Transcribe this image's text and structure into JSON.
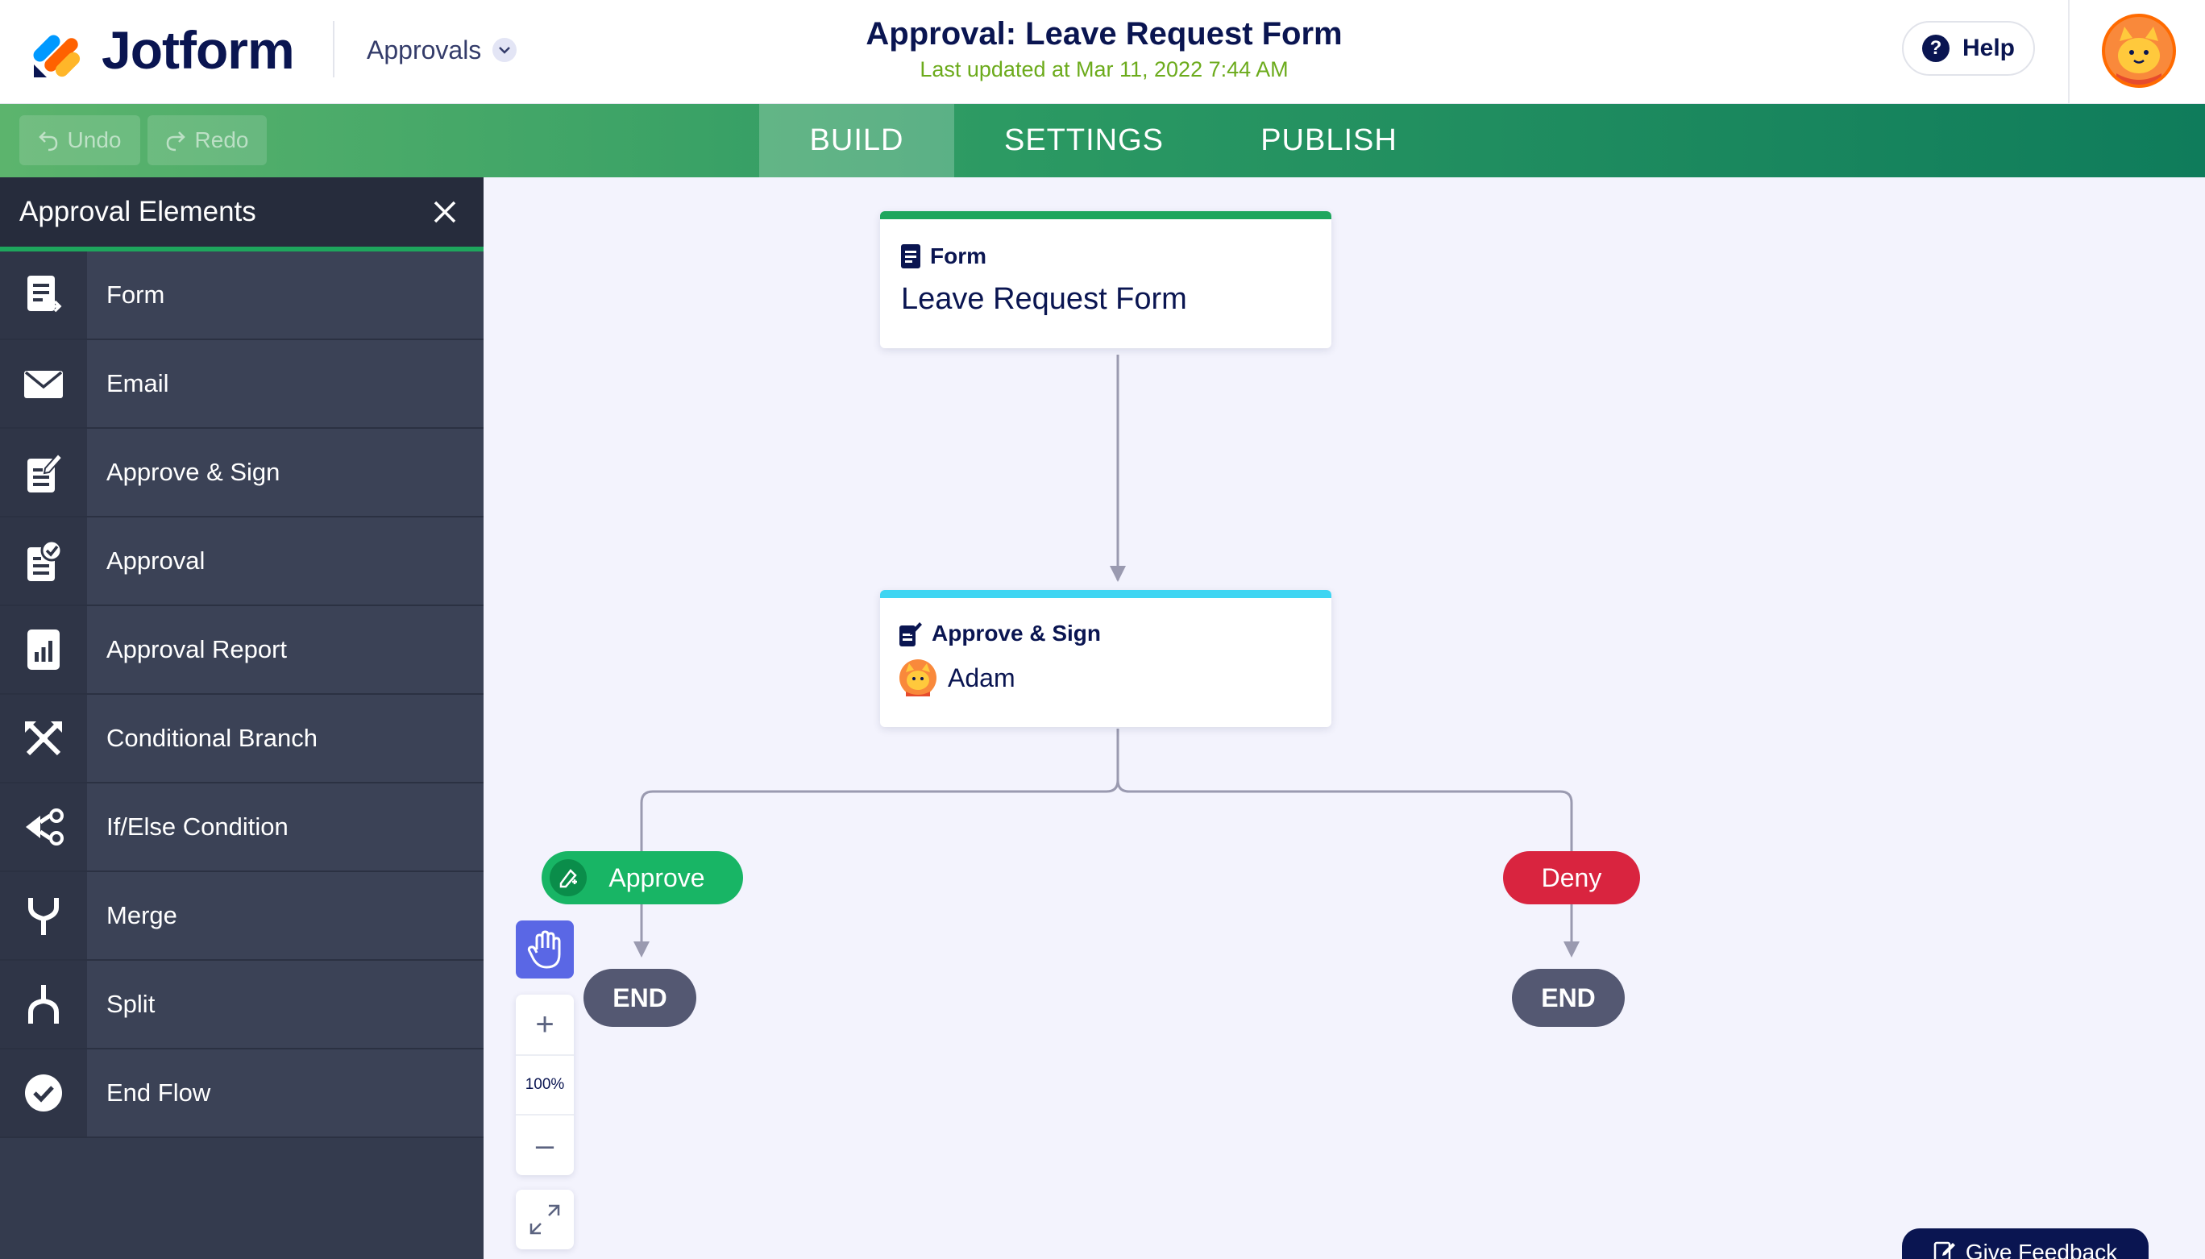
{
  "header": {
    "brand": "Jotform",
    "menu_label": "Approvals",
    "title": "Approval: Leave Request Form",
    "last_updated": "Last updated at Mar 11, 2022 7:44 AM",
    "help_label": "Help"
  },
  "toolbar": {
    "undo_label": "Undo",
    "redo_label": "Redo",
    "tabs": [
      {
        "label": "BUILD",
        "active": true
      },
      {
        "label": "SETTINGS",
        "active": false
      },
      {
        "label": "PUBLISH",
        "active": false
      }
    ]
  },
  "sidebar": {
    "title": "Approval Elements",
    "items": [
      {
        "label": "Form",
        "icon": "form-icon"
      },
      {
        "label": "Email",
        "icon": "envelope-icon"
      },
      {
        "label": "Approve & Sign",
        "icon": "approve-sign-icon"
      },
      {
        "label": "Approval",
        "icon": "approval-icon"
      },
      {
        "label": "Approval Report",
        "icon": "report-icon"
      },
      {
        "label": "Conditional Branch",
        "icon": "branch-icon"
      },
      {
        "label": "If/Else Condition",
        "icon": "if-else-icon"
      },
      {
        "label": "Merge",
        "icon": "merge-icon"
      },
      {
        "label": "Split",
        "icon": "split-icon"
      },
      {
        "label": "End Flow",
        "icon": "check-circle-icon"
      }
    ]
  },
  "flow": {
    "form_node": {
      "type_label": "Form",
      "name": "Leave Request Form",
      "accent": "#1ea65d"
    },
    "sign_node": {
      "type_label": "Approve & Sign",
      "assignee": "Adam",
      "accent": "#3fd5f2"
    },
    "approve_label": "Approve",
    "deny_label": "Deny",
    "end_label": "END",
    "approve_color": "#18b565",
    "deny_color": "#d9243f"
  },
  "zoom": {
    "level": "100%",
    "plus": "+",
    "minus": "–"
  },
  "feedback_label": "Give Feedback"
}
